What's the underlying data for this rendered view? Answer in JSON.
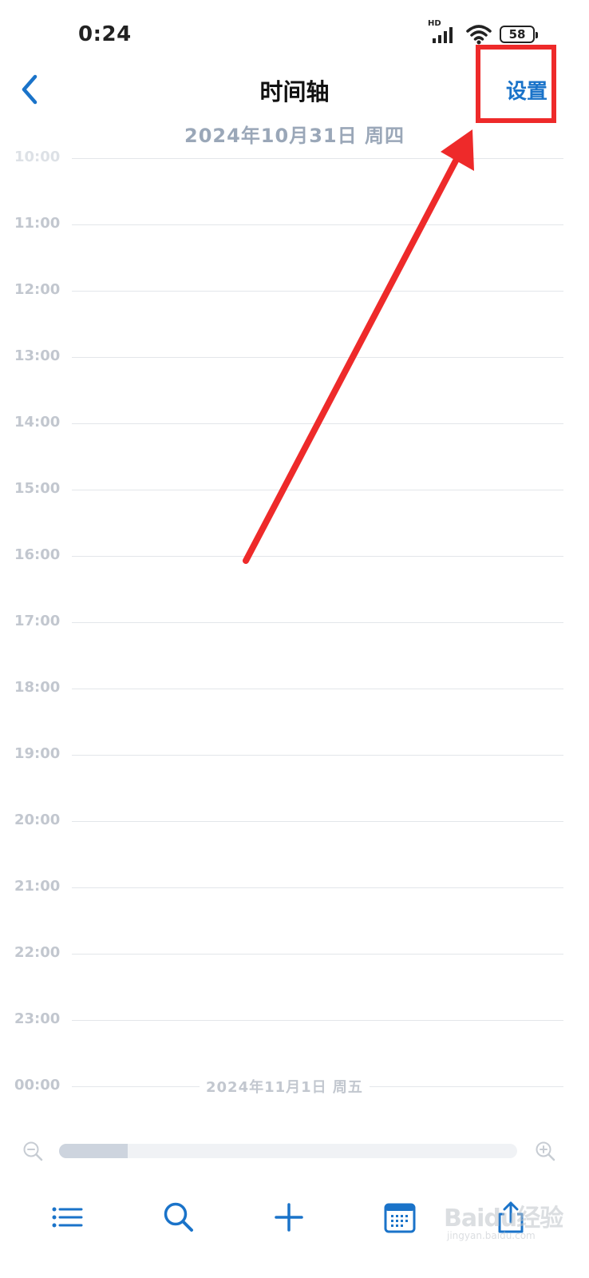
{
  "status_bar": {
    "time": "0:24",
    "network_label": "HD",
    "battery_level": "58"
  },
  "nav": {
    "title": "时间轴",
    "settings_label": "设置"
  },
  "timeline": {
    "date_header": "2024年10月31日 周四",
    "hours": [
      "10:00",
      "11:00",
      "12:00",
      "13:00",
      "14:00",
      "15:00",
      "16:00",
      "17:00",
      "18:00",
      "19:00",
      "20:00",
      "21:00",
      "22:00",
      "23:00",
      "00:00"
    ],
    "next_day_label": "2024年11月1日 周五"
  },
  "zoom": {
    "level_fraction": 0.15
  },
  "tab_bar": {
    "icons": [
      "list-icon",
      "search-icon",
      "add-icon",
      "calendar-icon",
      "share-icon"
    ]
  },
  "watermark": {
    "text": "Baidu经验",
    "sub": "jingyan.baidu.com"
  },
  "colors": {
    "accent": "#1a73c9",
    "annotation": "#ee2a2a",
    "muted_text": "#c2c7cf",
    "date_text": "#9aa7b8"
  }
}
